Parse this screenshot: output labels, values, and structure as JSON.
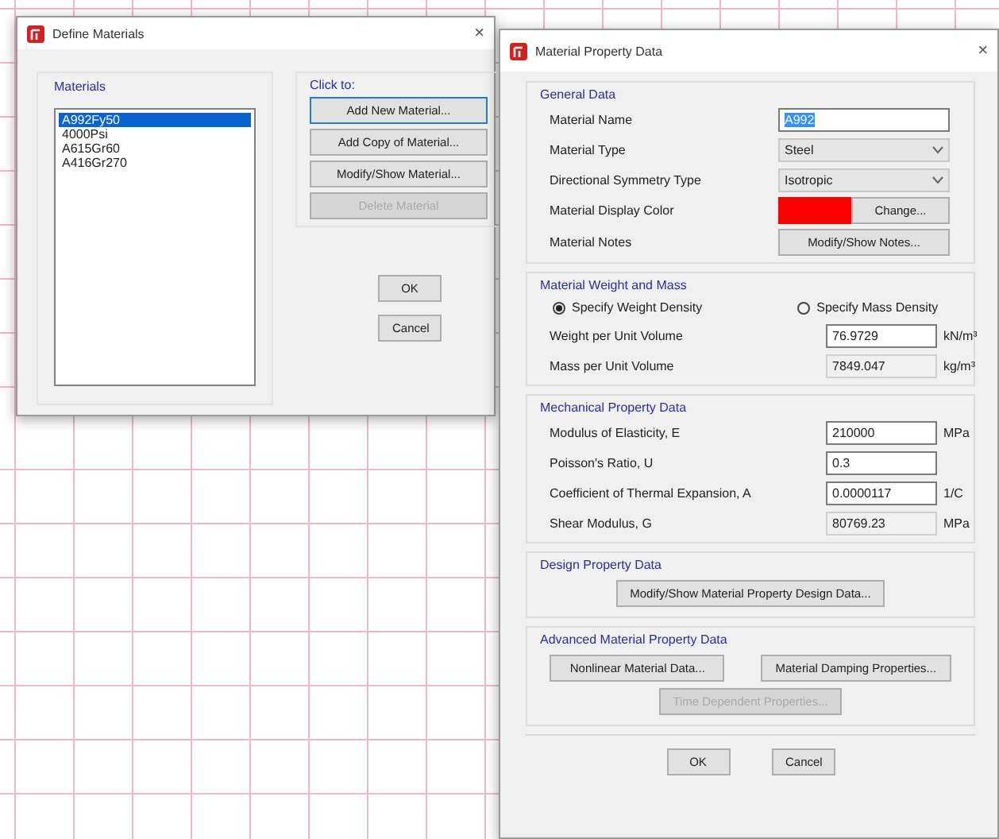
{
  "define_materials": {
    "title": "Define Materials",
    "close": "×",
    "materials_label": "Materials",
    "materials": [
      {
        "name": "A992Fy50",
        "selected": true
      },
      {
        "name": "4000Psi",
        "selected": false
      },
      {
        "name": "A615Gr60",
        "selected": false
      },
      {
        "name": "A416Gr270",
        "selected": false
      }
    ],
    "click_to_label": "Click to:",
    "actions": [
      {
        "label": "Add New Material...",
        "disabled": false,
        "focused": true
      },
      {
        "label": "Add Copy of Material...",
        "disabled": false,
        "focused": false
      },
      {
        "label": "Modify/Show Material...",
        "disabled": false,
        "focused": false
      },
      {
        "label": "Delete Material",
        "disabled": true,
        "focused": false
      }
    ],
    "buttons": [
      "OK",
      "Cancel"
    ]
  },
  "material_property_data": {
    "title": "Material Property Data",
    "close": "×",
    "groups": [
      {
        "title": "General Data",
        "rows": [
          {
            "kind": "text",
            "label": "Material Name",
            "value": "A992",
            "highlighted": true
          },
          {
            "kind": "select",
            "label": "Material Type",
            "value": "Steel"
          },
          {
            "kind": "select",
            "label": "Directional Symmetry Type",
            "value": "Isotropic"
          },
          {
            "kind": "color",
            "label": "Material Display Color",
            "color": "#ff0000",
            "button": "Change..."
          },
          {
            "kind": "button",
            "label": "Material Notes",
            "button": "Modify/Show Notes..."
          }
        ]
      },
      {
        "title": "Material Weight and Mass",
        "radios": [
          {
            "label": "Specify Weight Density",
            "selected": true
          },
          {
            "label": "Specify Mass Density",
            "selected": false
          }
        ],
        "rows": [
          {
            "kind": "number",
            "label": "Weight per Unit Volume",
            "value": "76.9729",
            "unit": "kN/m³",
            "readonly": false
          },
          {
            "kind": "number",
            "label": "Mass per Unit Volume",
            "value": "7849.047",
            "unit": "kg/m³",
            "readonly": true
          }
        ]
      },
      {
        "title": "Mechanical Property Data",
        "rows": [
          {
            "kind": "number",
            "label": "Modulus of Elasticity,  E",
            "value": "210000",
            "unit": "MPa",
            "readonly": false
          },
          {
            "kind": "number",
            "label": "Poisson's Ratio,  U",
            "value": "0.3",
            "readonly": false
          },
          {
            "kind": "number",
            "label": "Coefficient of Thermal Expansion,  A",
            "value": "0.0000117",
            "unit": "1/C",
            "readonly": false
          },
          {
            "kind": "number",
            "label": "Shear Modulus,  G",
            "value": "80769.23",
            "unit": "MPa",
            "readonly": true
          }
        ]
      },
      {
        "title": "Design Property Data",
        "actions": [
          {
            "label": "Modify/Show Material Property Design Data...",
            "disabled": false
          }
        ]
      },
      {
        "title": "Advanced Material Property Data",
        "actions": [
          {
            "label": "Nonlinear Material Data...",
            "disabled": false
          },
          {
            "label": "Material Damping Properties...",
            "disabled": false
          },
          {
            "label": "Time Dependent Properties...",
            "disabled": true
          }
        ]
      }
    ],
    "buttons": [
      "OK",
      "Cancel"
    ]
  }
}
